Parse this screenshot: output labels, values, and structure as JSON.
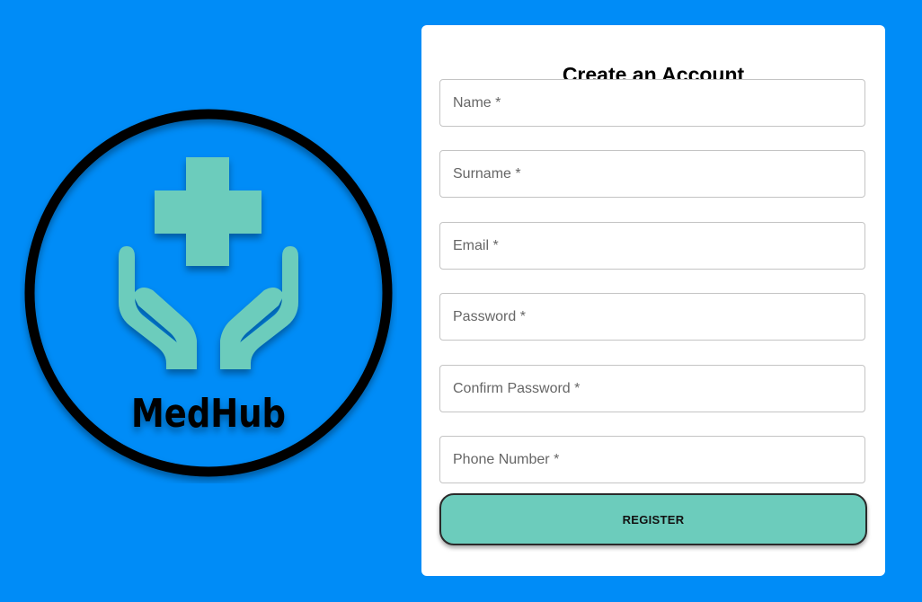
{
  "logo": {
    "brand_text": "MedHub",
    "icon": "medical-cross-hands-icon",
    "colors": {
      "accent": "#6CCCBC",
      "ring": "#000000"
    }
  },
  "form": {
    "title": "Create an Account",
    "fields": [
      {
        "placeholder": "Name *",
        "value": ""
      },
      {
        "placeholder": "Surname *",
        "value": ""
      },
      {
        "placeholder": "Email *",
        "value": ""
      },
      {
        "placeholder": "Password *",
        "value": ""
      },
      {
        "placeholder": "Confirm Password *",
        "value": ""
      },
      {
        "placeholder": "Phone Number *",
        "value": ""
      }
    ],
    "register_label": "REGISTER"
  },
  "colors": {
    "background": "#008CF7",
    "card": "#FFFFFF",
    "button": "#6CCCBC"
  }
}
